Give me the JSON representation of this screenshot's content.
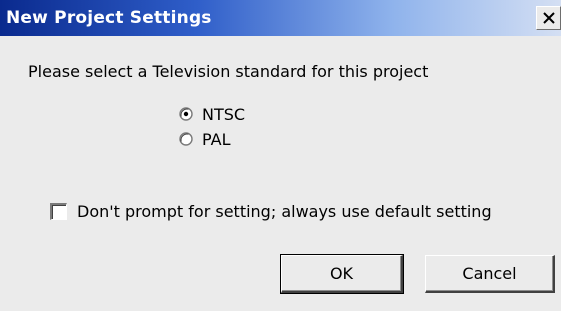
{
  "window": {
    "title": "New Project Settings",
    "close_glyph": "×",
    "close_icon": "close-icon"
  },
  "prompt": "Please select a Television standard for this project",
  "standards": [
    {
      "label": "NTSC",
      "selected": true
    },
    {
      "label": "PAL",
      "selected": false
    }
  ],
  "dont_prompt": {
    "label": "Don't prompt for setting; always use default setting",
    "checked": false
  },
  "buttons": {
    "ok": "OK",
    "cancel": "Cancel"
  },
  "colors": {
    "title_start": "#0a2a8e",
    "title_end": "#d4dff3",
    "dialog_bg": "#ebebeb"
  }
}
